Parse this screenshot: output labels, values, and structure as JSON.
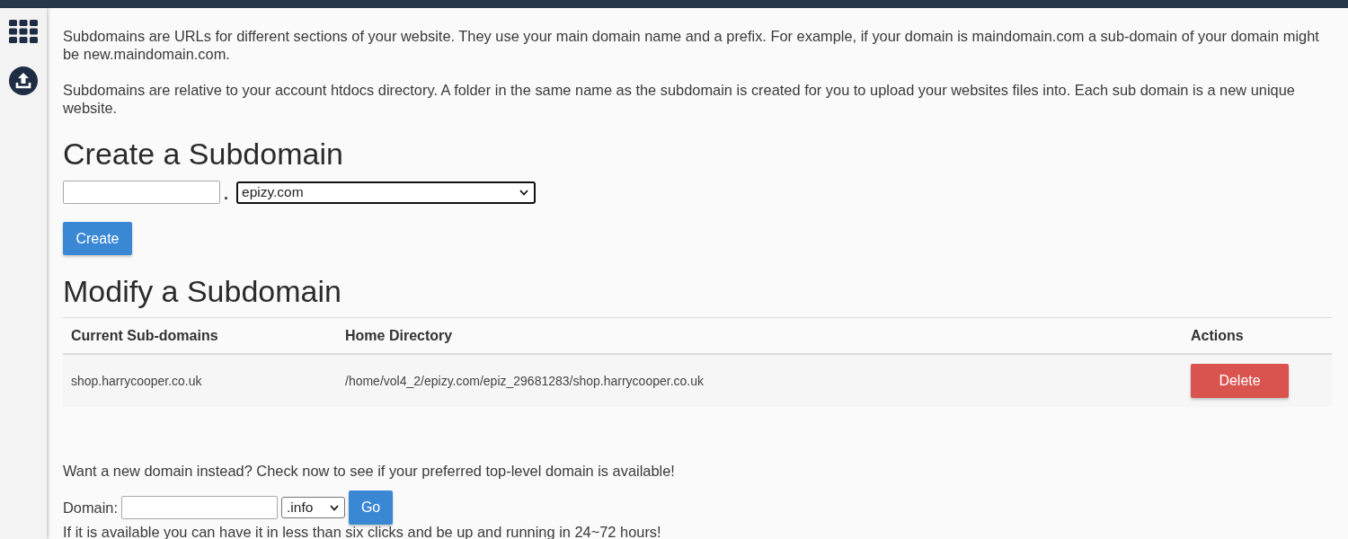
{
  "intro": {
    "paragraphs": [
      "Subdomains are URLs for different sections of your website. They use your main domain name and a prefix. For example, if your domain is maindomain.com a sub-domain of your domain might be new.maindomain.com.",
      "Subdomains are relative to your account htdocs directory. A folder in the same name as the subdomain is created for you to upload your websites files into. Each sub domain is a new unique website."
    ]
  },
  "create_subdomain": {
    "title": "Create a Subdomain",
    "separator": ".",
    "domain_select": {
      "value": "epizy.com",
      "focused": true
    },
    "create_button": "Create"
  },
  "modify_subdomain": {
    "title": "Modify a Subdomain",
    "table": {
      "columns": [
        "Current Sub-domains",
        "Home Directory",
        "Actions"
      ],
      "rows": [
        {
          "subdomain": "shop.harrycooper.co.uk",
          "home_directory": "/home/vol4_2/epizy.com/epiz_29681283/shop.harrycooper.co.uk",
          "action": "Delete"
        }
      ]
    }
  },
  "domain_search": {
    "prompt": "Want a new domain instead? Check now to see if your preferred top-level domain is available!",
    "label": "Domain:",
    "tld_select": {
      "value": ".info",
      "focused": false
    },
    "go_button": "Go",
    "note": "If it is available you can have it in less than six clicks and be up and running in 24~72 hours!"
  }
}
